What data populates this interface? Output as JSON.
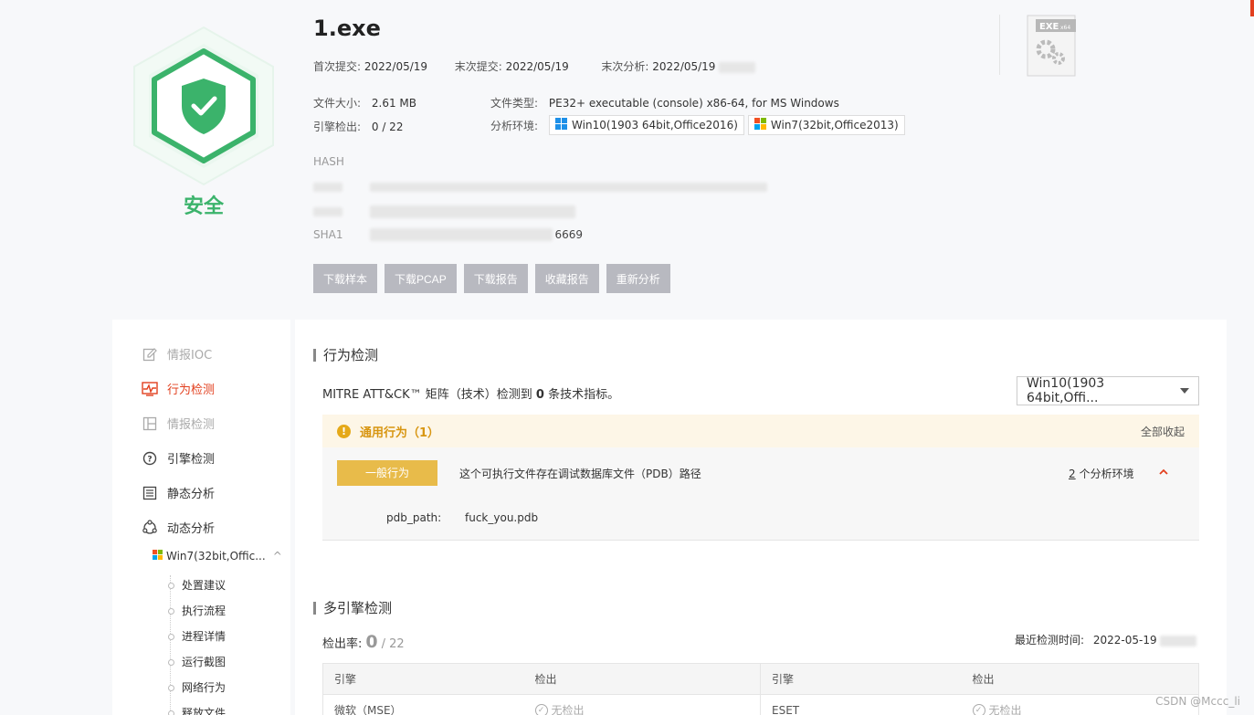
{
  "header": {
    "file_name": "1.exe",
    "verdict": "安全",
    "first_submit_label": "首次提交:",
    "first_submit_value": "2022/05/19",
    "last_submit_label": "末次提交:",
    "last_submit_value": "2022/05/19",
    "last_analysis_label": "末次分析:",
    "last_analysis_value": "2022/05/19",
    "file_size_label": "文件大小:",
    "file_size_value": "2.61 MB",
    "engine_detect_label": "引擎检出:",
    "engine_detect_value": "0 / 22",
    "file_type_label": "文件类型:",
    "file_type_value": "PE32+ executable (console) x86-64, for MS Windows",
    "analysis_env_label": "分析环境:",
    "envs": [
      "Win10(1903 64bit,Office2016)",
      "Win7(32bit,Office2013)"
    ],
    "hash_label": "HASH",
    "sha1_label": "SHA1",
    "sha1_tail": "6669",
    "file_icon_label": "EXE",
    "file_icon_sub": "x64",
    "buttons": [
      "下载样本",
      "下载PCAP",
      "下载报告",
      "收藏报告",
      "重新分析"
    ]
  },
  "nav": {
    "items": [
      {
        "label": "情报IOC",
        "state": "dim",
        "icon": "edit-icon"
      },
      {
        "label": "行为检测",
        "state": "active",
        "icon": "heartbeat-icon"
      },
      {
        "label": "情报检测",
        "state": "dim",
        "icon": "layout-icon"
      },
      {
        "label": "引擎检测",
        "state": "normal",
        "icon": "help-circle-icon"
      },
      {
        "label": "静态分析",
        "state": "normal",
        "icon": "list-icon"
      },
      {
        "label": "动态分析",
        "state": "normal",
        "icon": "cycle-icon"
      }
    ],
    "sub_env": "Win7(32bit,Offic...",
    "sub_items": [
      "处置建议",
      "执行流程",
      "进程详情",
      "运行截图",
      "网络行为",
      "释放文件"
    ]
  },
  "behavior": {
    "title": "行为检测",
    "mitre_prefix": "MITRE ATT&CK™ 矩阵（技术）检测到",
    "mitre_count": "0",
    "mitre_suffix": "条技术指标。",
    "env_select": "Win10(1903 64bit,Offi...",
    "group_title": "通用行为（1）",
    "collapse_all": "全部收起",
    "level_tag": "一般行为",
    "description": "这个可执行文件存在调试数据库文件（PDB）路径",
    "env_count_num": "2",
    "env_count_suffix": "个分析环境",
    "kv_key": "pdb_path:",
    "kv_value": "fuck_you.pdb"
  },
  "engines": {
    "title": "多引擎检测",
    "rate_label": "检出率:",
    "rate_value": "0",
    "rate_total": "/ 22",
    "last_time_label": "最近检测时间:",
    "last_time_value": "2022-05-19",
    "columns": [
      "引擎",
      "检出",
      "引擎",
      "检出"
    ],
    "rows": [
      {
        "engine1": "微软（MSE）",
        "result1": "无检出",
        "engine2": "ESET",
        "result2": "无检出"
      }
    ]
  },
  "watermark": "CSDN @Mccc_li",
  "colors": {
    "safe_green": "#3bb36b",
    "active_red": "#e2401f",
    "warn_yellow": "#e5a919",
    "button_gray": "#b8b9c0"
  }
}
